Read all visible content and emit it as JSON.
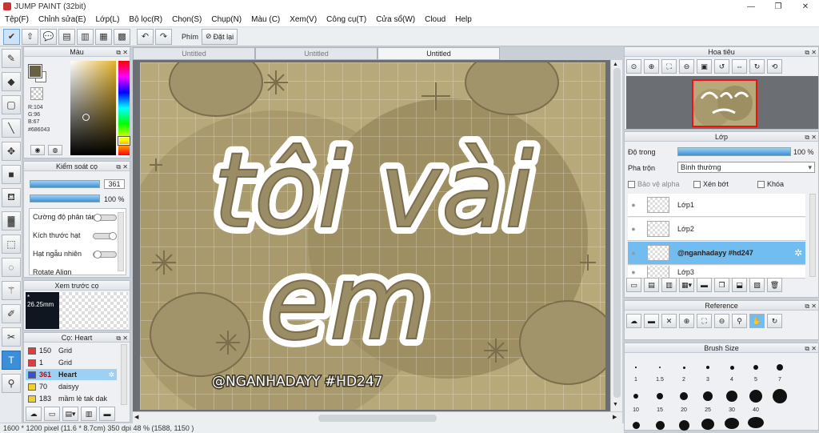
{
  "window": {
    "title": "JUMP PAINT (32bit)",
    "controls": [
      "—",
      "❐",
      "✕"
    ]
  },
  "menu": [
    "Tệp(F)",
    "Chỉnh sửa(E)",
    "Lớp(L)",
    "Bộ lọc(R)",
    "Chọn(S)",
    "Chụp(N)",
    "Màu (C)",
    "Xem(V)",
    "Công cụ(T)",
    "Cửa sổ(W)",
    "Cloud",
    "Help"
  ],
  "toolbar": {
    "phim_label": "Phím",
    "reset_label": "Đặt lại"
  },
  "tabs": [
    {
      "label": "Untitled",
      "active": false
    },
    {
      "label": "Untitled",
      "active": false
    },
    {
      "label": "Untitled",
      "active": true
    }
  ],
  "color_panel": {
    "title": "Màu",
    "r": "R:104",
    "g": "G:96",
    "b": "B:67",
    "hex": "#686043",
    "current_color": "#686043"
  },
  "brush_control": {
    "title": "Kiểm soát cọ",
    "size_value": "361",
    "opacity_value": "100 %",
    "rows": [
      "Cường độ phân tán",
      "Kích thước hạt",
      "Hạt ngẫu nhiên",
      "Rotate Align"
    ]
  },
  "preview": {
    "title": "Xem trước cọ",
    "size": "26.25mm"
  },
  "brush_list": {
    "title": "Cọ: Heart",
    "items": [
      {
        "num": "150",
        "name": "Grid",
        "color": "#e33b3b"
      },
      {
        "num": "1",
        "name": "Grid",
        "color": "#e33b3b"
      },
      {
        "num": "361",
        "name": "Heart",
        "color": "#3a4fd0",
        "active": true
      },
      {
        "num": "70",
        "name": "daisyy",
        "color": "#f0d02a"
      },
      {
        "num": "183",
        "name": "mầm lè tak dak",
        "color": "#f0d02a"
      }
    ]
  },
  "navigator": {
    "title": "Hoa tiêu"
  },
  "layers": {
    "title": "Lớp",
    "opacity_label": "Độ trong",
    "opacity_value": "100 %",
    "blend_label": "Pha trộn",
    "blend_value": "Bình thường",
    "protect_alpha": "Bảo vệ alpha",
    "clipping": "Xén bớt",
    "lock": "Khóa",
    "items": [
      {
        "name": "Lớp1",
        "active": false
      },
      {
        "name": "Lớp2",
        "active": false
      },
      {
        "name": "@nganhadayy #hd247",
        "active": true
      },
      {
        "name": "Lớp3",
        "active": false
      }
    ]
  },
  "reference": {
    "title": "Reference"
  },
  "brush_size": {
    "title": "Brush Size",
    "row1": [
      "1",
      "1.5",
      "2",
      "3",
      "4",
      "5",
      "7"
    ],
    "row2": [
      "10",
      "15",
      "20",
      "25",
      "30",
      "40"
    ]
  },
  "artwork": {
    "title_line1": "tôi vài",
    "title_line2": "em",
    "watermark": "@NGANHADAYY #HD247"
  },
  "status": {
    "text": "1600 * 1200 pixel   (11.6 * 8.7cm)   350 dpi   48 %   (1588, 1150 )"
  }
}
